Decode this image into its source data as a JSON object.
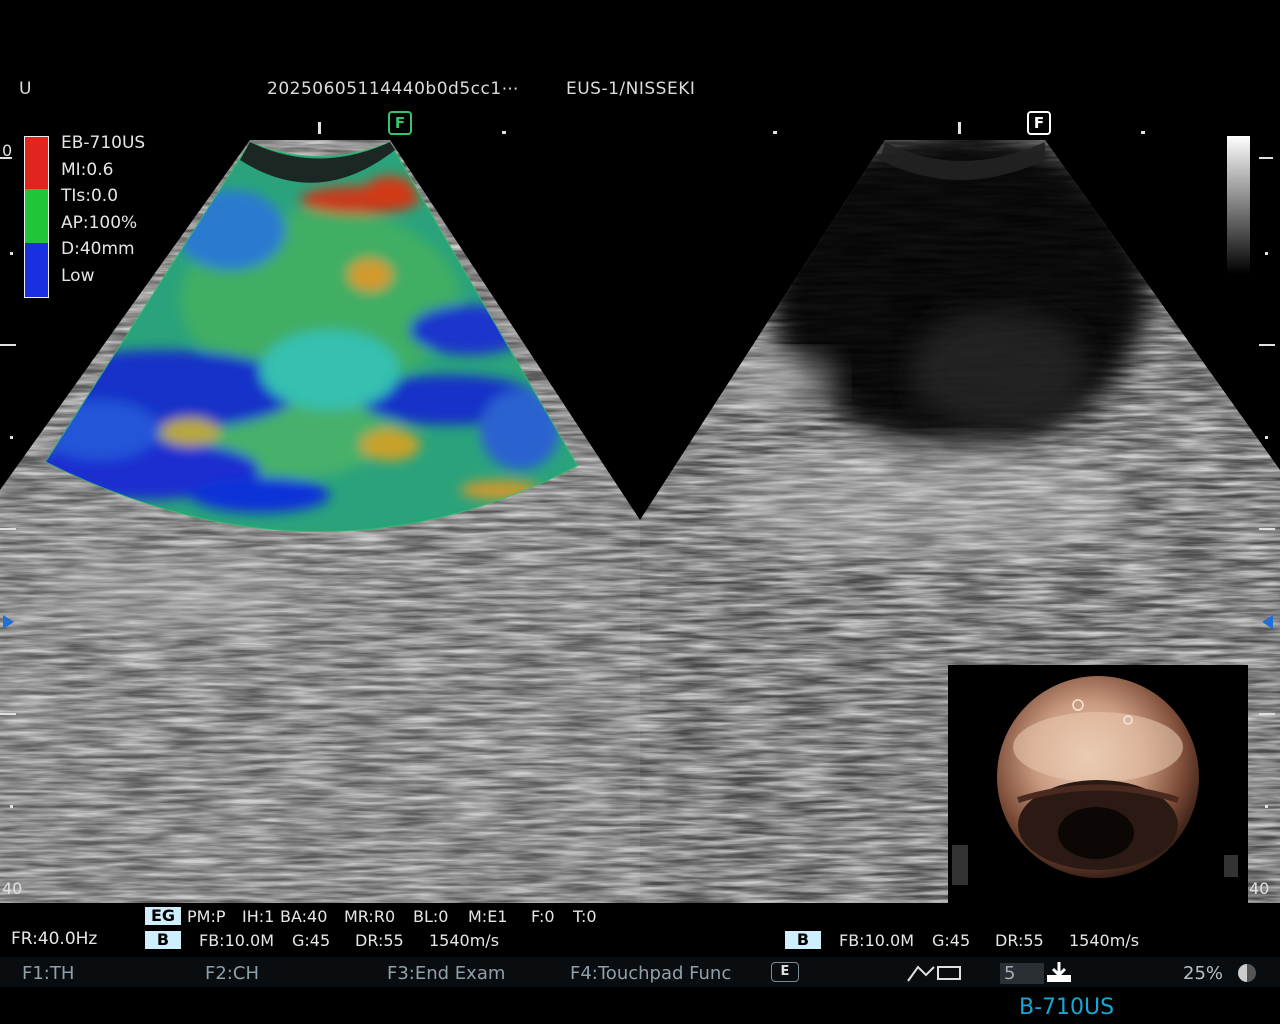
{
  "header": {
    "orientation": "U",
    "exam_id": "20250605114440b0d5cc1⋯",
    "site": "EUS-1/NISSEKI"
  },
  "left_info": {
    "probe": "EB-710US",
    "mi": "MI:0.6",
    "tis": "TIs:0.0",
    "ap": "AP:100%",
    "depth": "D:40mm",
    "power": "Low"
  },
  "focus_marker": "F",
  "scale": {
    "top": "0",
    "bottom": "40"
  },
  "colors": {
    "badge": "#cfeffc",
    "focus_green": "#36c36a",
    "scale_blue": "#1f6fd6"
  },
  "status": {
    "frame_rate": "FR:40.0Hz",
    "eg_badge": "EG",
    "b_badge": "B",
    "left_row1": [
      "PM:P",
      "IH:1",
      "BA:40",
      "MR:R0",
      "BL:0",
      "M:E1",
      "F:0",
      "T:0"
    ],
    "left_row2": [
      "FB:10.0M",
      "G:45",
      "DR:55",
      "1540m/s"
    ],
    "right_row": [
      "FB:10.0M",
      "G:45",
      "DR:55",
      "1540m/s"
    ]
  },
  "function_keys": {
    "f1": "F1:TH",
    "f2": "F2:CH",
    "f3": "F3:End Exam",
    "f4": "F4:Touchpad Func",
    "count": "5",
    "zoom": "25%"
  },
  "footer_model": "B-710US",
  "icons": [
    "elasto-e-icon",
    "image-toggle-icon",
    "download-icon",
    "half-circle-icon"
  ]
}
